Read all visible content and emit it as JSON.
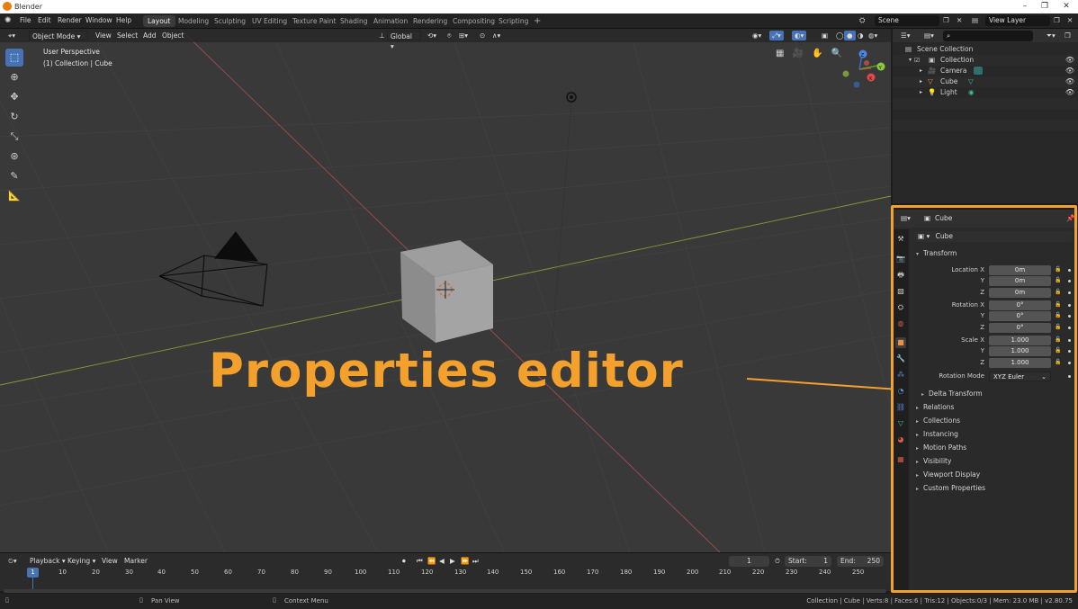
{
  "window": {
    "title": "Blender",
    "minimize": "–",
    "maximize": "❐",
    "close": "✕"
  },
  "menu": [
    "File",
    "Edit",
    "Render",
    "Window",
    "Help"
  ],
  "workspaces": [
    "Layout",
    "Modeling",
    "Sculpting",
    "UV Editing",
    "Texture Paint",
    "Shading",
    "Animation",
    "Rendering",
    "Compositing",
    "Scripting"
  ],
  "workspace_add": "+",
  "scene": {
    "name": "Scene",
    "view_layer": "View Layer"
  },
  "viewport_header": {
    "mode": "Object Mode",
    "menus": [
      "View",
      "Select",
      "Add",
      "Object"
    ],
    "orientation": "Global"
  },
  "viewport_info": {
    "perspective": "User Perspective",
    "collection": "(1) Collection | Cube"
  },
  "gizmo": {
    "x": "X",
    "y": "Y",
    "z": "Z"
  },
  "annotation": {
    "label": "Properties editor"
  },
  "outliner": {
    "root": "Scene Collection",
    "collection": "Collection",
    "items": [
      "Camera",
      "Cube",
      "Light"
    ]
  },
  "properties": {
    "object_name": "Cube",
    "datablock_name": "Cube",
    "transform_title": "Transform",
    "location": {
      "label_x": "Location X",
      "label_y": "Y",
      "label_z": "Z",
      "x": "0m",
      "y": "0m",
      "z": "0m"
    },
    "rotation": {
      "label_x": "Rotation X",
      "label_y": "Y",
      "label_z": "Z",
      "x": "0°",
      "y": "0°",
      "z": "0°"
    },
    "scale": {
      "label_x": "Scale X",
      "label_y": "Y",
      "label_z": "Z",
      "x": "1.000",
      "y": "1.000",
      "z": "1.000"
    },
    "rotation_mode_label": "Rotation Mode",
    "rotation_mode": "XYZ Euler",
    "sections": [
      "Delta Transform",
      "Relations",
      "Collections",
      "Instancing",
      "Motion Paths",
      "Visibility",
      "Viewport Display",
      "Custom Properties"
    ]
  },
  "timeline": {
    "menus": [
      "Playback",
      "Keying",
      "View",
      "Marker"
    ],
    "current_frame": "1",
    "start_label": "Start:",
    "start": "1",
    "end_label": "End:",
    "end": "250",
    "ticks": [
      "10",
      "20",
      "30",
      "40",
      "50",
      "60",
      "70",
      "80",
      "90",
      "100",
      "110",
      "120",
      "130",
      "140",
      "150",
      "160",
      "170",
      "180",
      "190",
      "200",
      "210",
      "220",
      "230",
      "240",
      "250"
    ],
    "cursor": "1"
  },
  "statusbar": {
    "pan": "Pan View",
    "context": "Context Menu",
    "stats": "Collection | Cube | Verts:8 | Faces:6 | Tris:12 | Objects:0/3 | Mem: 23.0 MB | v2.80.75"
  },
  "colors": {
    "accent": "#f4a02c",
    "active_blue": "#4772b3",
    "viewport_bg": "#393939"
  }
}
